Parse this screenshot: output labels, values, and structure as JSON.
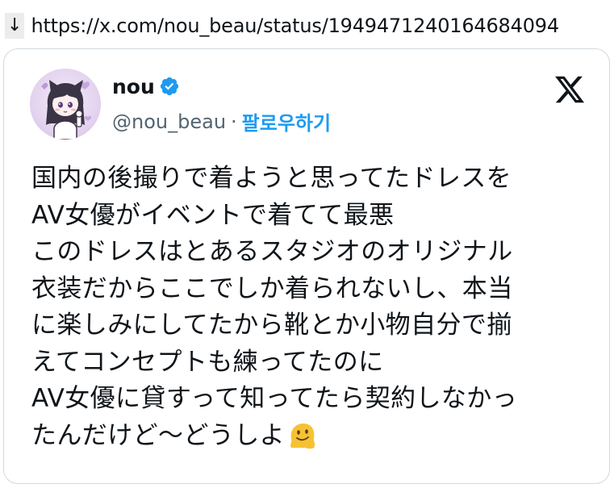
{
  "url_bar": {
    "arrow": "↓",
    "url": "https://x.com/nou_beau/status/1949471240164684094"
  },
  "tweet": {
    "author_name": "nou",
    "handle": "@nou_beau",
    "separator": "·",
    "follow_label": "팔로우하기",
    "lines": [
      "国内の後撮りで着ようと思ってたドレスを",
      "AV女優がイベントで着てて最悪",
      "このドレスはとあるスタジオのオリジナル",
      "衣装だからここでしか着られないし、本当",
      "に楽しみにしてたから靴とか小物自分で揃",
      "えてコンセプトも練ってたのに",
      "AV女優に貸すって知ってたら契約しなかっ",
      "たんだけど〜どうしよ"
    ],
    "emoji": "melting-face-emoji"
  },
  "colors": {
    "accent": "#1d9bf0",
    "text": "#0f1419",
    "secondary": "#536471",
    "border": "#cfd9de"
  },
  "icons": {
    "verified": "verified-badge-icon",
    "brand": "x-logo-icon"
  }
}
